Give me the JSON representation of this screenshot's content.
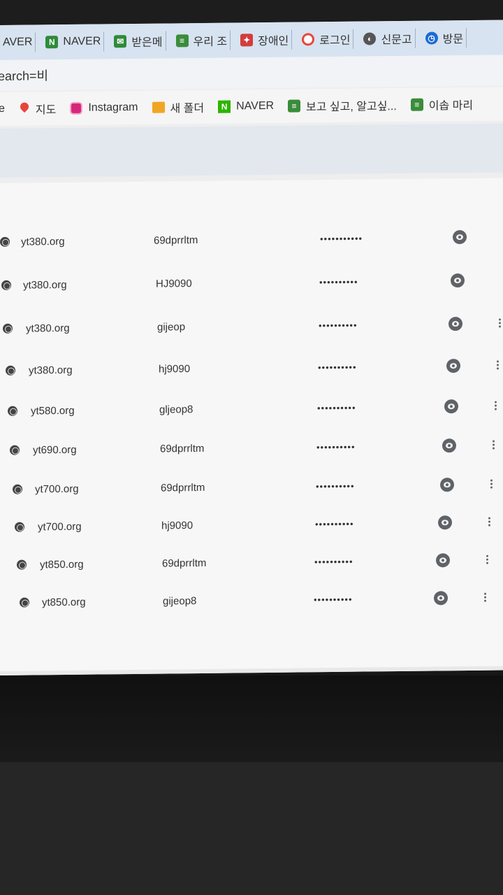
{
  "tabs": [
    {
      "label": "AVER",
      "icon": "none"
    },
    {
      "label": "NAVER",
      "icon": "naver-icon"
    },
    {
      "label": "받은메",
      "icon": "mail-icon"
    },
    {
      "label": "우리 조",
      "icon": "docs-icon"
    },
    {
      "label": "장애인",
      "icon": "flag-icon"
    },
    {
      "label": "로그인",
      "icon": "google-icon"
    },
    {
      "label": "신문고",
      "icon": "globe-icon"
    },
    {
      "label": "방문",
      "icon": "clock-icon"
    }
  ],
  "address": {
    "text": "earch=비"
  },
  "bookmarks": [
    {
      "label": "e",
      "icon": "none"
    },
    {
      "label": "지도",
      "icon": "map-pin-icon"
    },
    {
      "label": "Instagram",
      "icon": "instagram-icon"
    },
    {
      "label": "새 폴더",
      "icon": "folder-icon"
    },
    {
      "label": "NAVER",
      "icon": "naver-icon"
    },
    {
      "label": "보고 싶고, 알고싶...",
      "icon": "docs-icon"
    },
    {
      "label": "이솝 마리",
      "icon": "docs-icon"
    }
  ],
  "passwords": [
    {
      "site": "yt380.org",
      "username": "69dprrltm",
      "password": "•••••••••••"
    },
    {
      "site": "yt380.org",
      "username": "HJ9090",
      "password": "••••••••••"
    },
    {
      "site": "yt380.org",
      "username": "gijeop",
      "password": "••••••••••"
    },
    {
      "site": "yt380.org",
      "username": "hj9090",
      "password": "••••••••••"
    },
    {
      "site": "yt580.org",
      "username": "gljeop8",
      "password": "••••••••••"
    },
    {
      "site": "yt690.org",
      "username": "69dprrltm",
      "password": "••••••••••"
    },
    {
      "site": "yt700.org",
      "username": "69dprrltm",
      "password": "••••••••••"
    },
    {
      "site": "yt700.org",
      "username": "hj9090",
      "password": "••••••••••"
    },
    {
      "site": "yt850.org",
      "username": "69dprrltm",
      "password": "••••••••••"
    },
    {
      "site": "yt850.org",
      "username": "gijeop8",
      "password": "••••••••••"
    }
  ],
  "colors": {
    "chrome_tab_bg": "#d7e3f0",
    "page_bg": "#f7f7f7",
    "icon_gray": "#5f6368"
  }
}
